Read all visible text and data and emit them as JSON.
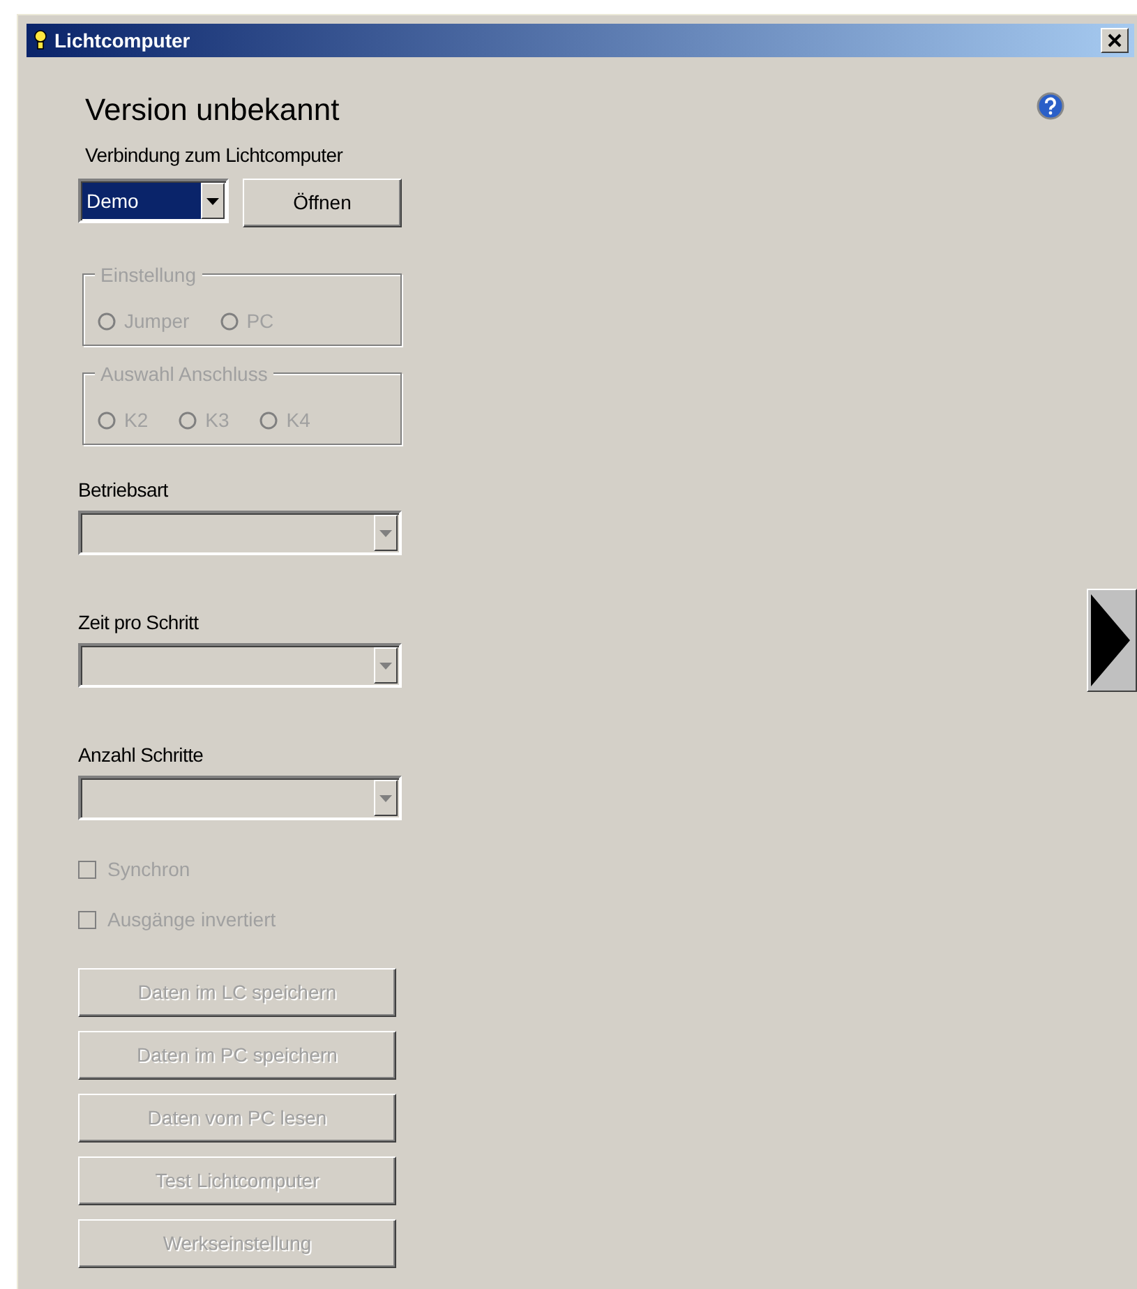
{
  "window": {
    "title": "Lichtcomputer"
  },
  "heading": "Version unbekannt",
  "connection": {
    "label": "Verbindung zum Lichtcomputer",
    "value": "Demo",
    "button": "Öffnen"
  },
  "groups": [
    {
      "title": "Einstellung",
      "disabled": true,
      "options": [
        {
          "label": "Jumper",
          "selected": false
        },
        {
          "label": "PC",
          "selected": false
        }
      ]
    },
    {
      "title": "Auswahl Anschluss",
      "disabled": true,
      "options": [
        {
          "label": "K2",
          "selected": false
        },
        {
          "label": "K3",
          "selected": false
        },
        {
          "label": "K4",
          "selected": false
        }
      ]
    }
  ],
  "dropdowns": [
    {
      "label": "Betriebsart",
      "disabled": true
    },
    {
      "label": "Zeit pro Schritt",
      "disabled": true
    },
    {
      "label": "Anzahl Schritte",
      "disabled": true
    }
  ],
  "checkboxes": [
    {
      "label": "Synchron",
      "checked": false,
      "disabled": true
    },
    {
      "label": "Ausgänge invertiert",
      "checked": false,
      "disabled": true
    }
  ],
  "buttons": [
    {
      "label": "Daten im LC speichern",
      "disabled": true
    },
    {
      "label": "Daten im PC speichern",
      "disabled": true
    },
    {
      "label": "Daten vom PC lesen",
      "disabled": true
    },
    {
      "label": "Test Lichtcomputer",
      "disabled": true
    },
    {
      "label": "Werkseinstellung",
      "disabled": true
    }
  ]
}
